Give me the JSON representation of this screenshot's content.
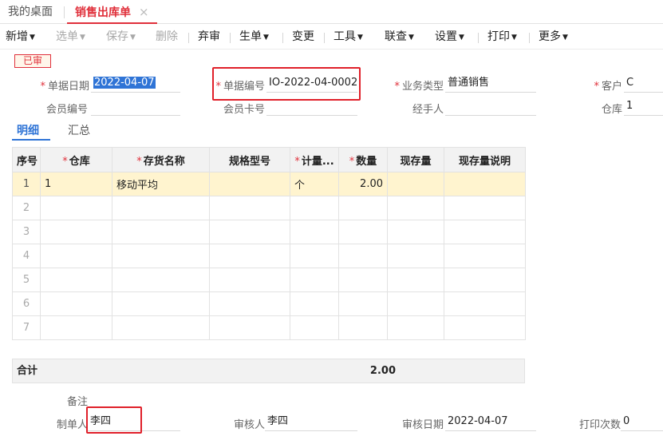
{
  "tabs": {
    "home": "我的桌面",
    "active": "销售出库单",
    "close": "×"
  },
  "toolbar": {
    "new": "新增",
    "pick": "选单",
    "save": "保存",
    "delete": "删除",
    "abandon_audit": "弃审",
    "gen": "生单",
    "change": "变更",
    "tools": "工具",
    "query": "联查",
    "settings": "设置",
    "print": "打印",
    "more": "更多",
    "caret": "▼"
  },
  "status": "已审",
  "form": {
    "date_label": "单据日期",
    "date_value": "2022-04-07",
    "code_label": "单据编号",
    "code_value": "IO-2022-04-0002",
    "biz_label": "业务类型",
    "biz_value": "普通销售",
    "customer_label": "客户",
    "customer_value": "C",
    "member_label": "会员编号",
    "member_value": "",
    "card_label": "会员卡号",
    "card_value": "",
    "handler_label": "经手人",
    "handler_value": "",
    "warehouse_label": "仓库",
    "warehouse_value": "1",
    "required_mark": "*"
  },
  "detail_tabs": {
    "detail": "明细",
    "summary": "汇总"
  },
  "grid": {
    "headers": [
      "序号",
      "仓库",
      "存货名称",
      "规格型号",
      "计量...",
      "数量",
      "现存量",
      "现存量说明"
    ],
    "rows": [
      {
        "idx": "1",
        "warehouse": "1",
        "item": "移动平均",
        "spec": "",
        "unit": "个",
        "qty": "2.00",
        "stock": "",
        "stock_note": ""
      },
      {
        "idx": "2"
      },
      {
        "idx": "3"
      },
      {
        "idx": "4"
      },
      {
        "idx": "5"
      },
      {
        "idx": "6"
      },
      {
        "idx": "7"
      }
    ]
  },
  "totals": {
    "label": "合计",
    "qty": "2.00"
  },
  "footer": {
    "remark_label": "备注",
    "maker_label": "制单人",
    "maker_value": "李四",
    "auditor_label": "审核人",
    "auditor_value": "李四",
    "audit_date_label": "审核日期",
    "audit_date_value": "2022-04-07",
    "print_count_label": "打印次数",
    "print_count_value": "0"
  },
  "colors": {
    "accent": "#e0303b",
    "link": "#2f74d6",
    "highlight_row": "#fff4cf",
    "annotation_box": "#e0202a"
  }
}
